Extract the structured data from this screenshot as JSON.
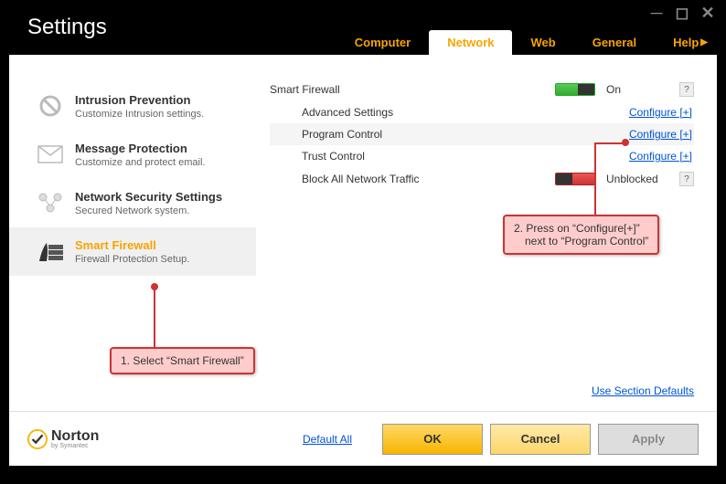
{
  "title": "Settings",
  "tabs": {
    "computer": "Computer",
    "network": "Network",
    "web": "Web",
    "general": "General",
    "help": "Help"
  },
  "sidebar": {
    "items": [
      {
        "title": "Intrusion Prevention",
        "desc": "Customize Intrusion settings."
      },
      {
        "title": "Message Protection",
        "desc": "Customize and protect email."
      },
      {
        "title": "Network Security Settings",
        "desc": "Secured Network system."
      },
      {
        "title": "Smart Firewall",
        "desc": "Firewall Protection Setup."
      }
    ]
  },
  "main": {
    "heading": "Smart Firewall",
    "status_on": "On",
    "rows": {
      "advanced": "Advanced Settings",
      "program": "Program Control",
      "trust": "Trust Control",
      "block": "Block All Network Traffic"
    },
    "unblocked": "Unblocked",
    "configure": "Configure [+]",
    "section_defaults": "Use Section Defaults"
  },
  "footer": {
    "logo": "Norton",
    "logo_sub": "by Symantec",
    "default_all": "Default All",
    "ok": "OK",
    "cancel": "Cancel",
    "apply": "Apply"
  },
  "annotations": {
    "a1": "1. Select “Smart Firewall”",
    "a2_l1": "2. Press on “Configure[+]”",
    "a2_l2": "next to “Program Control”"
  }
}
